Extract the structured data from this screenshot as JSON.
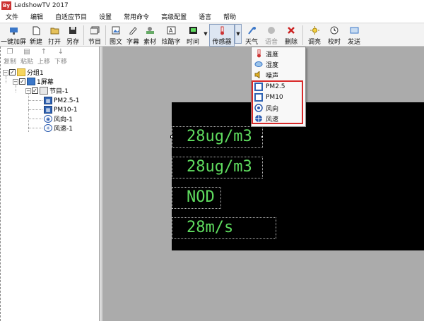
{
  "window": {
    "title": "LedshowTV 2017",
    "logo_text": "By"
  },
  "menu": [
    "文件",
    "编辑",
    "自适应节目",
    "设置",
    "常用命令",
    "高级配置",
    "语言",
    "帮助"
  ],
  "toolbar": [
    {
      "label": "一键加屏",
      "icon": "add-screen-icon"
    },
    {
      "label": "新建",
      "icon": "new-file-icon"
    },
    {
      "label": "打开",
      "icon": "open-folder-icon"
    },
    {
      "label": "另存",
      "icon": "save-icon"
    },
    {
      "label": "节目",
      "icon": "program-icon"
    },
    {
      "label": "图文",
      "icon": "image-text-icon"
    },
    {
      "label": "字幕",
      "icon": "subtitle-icon"
    },
    {
      "label": "素材",
      "icon": "material-icon"
    },
    {
      "label": "炫酷字",
      "icon": "cool-text-icon"
    },
    {
      "label": "时间",
      "icon": "clock-icon"
    },
    {
      "label": "传感器",
      "icon": "sensor-icon"
    },
    {
      "label": "天气",
      "icon": "weather-icon"
    },
    {
      "label": "语音",
      "icon": "voice-icon"
    },
    {
      "label": "删除",
      "icon": "delete-icon"
    },
    {
      "label": "调亮",
      "icon": "brightness-icon"
    },
    {
      "label": "校时",
      "icon": "time-sync-icon"
    },
    {
      "label": "发送",
      "icon": "send-icon"
    }
  ],
  "left_toolbar": [
    {
      "label": "复制",
      "icon": "copy-icon"
    },
    {
      "label": "粘贴",
      "icon": "paste-icon"
    },
    {
      "label": "上移",
      "icon": "up-arrow-icon"
    },
    {
      "label": "下移",
      "icon": "down-arrow-icon"
    }
  ],
  "tree": {
    "group": "分组1",
    "screen": "1屏幕",
    "program": "节目-1",
    "items": [
      "PM2.5-1",
      "PM10-1",
      "风向-1",
      "风速-1"
    ]
  },
  "sensor_menu": [
    "温度",
    "湿度",
    "噪声",
    "PM2.5",
    "PM10",
    "风向",
    "风速"
  ],
  "display_areas": [
    "28ug/m3",
    "28ug/m3",
    "NOD",
    "28m/s"
  ],
  "colors": {
    "led_text": "#5fdc5f",
    "highlight_border": "#d82a2a",
    "canvas_bg": "#ababab"
  }
}
